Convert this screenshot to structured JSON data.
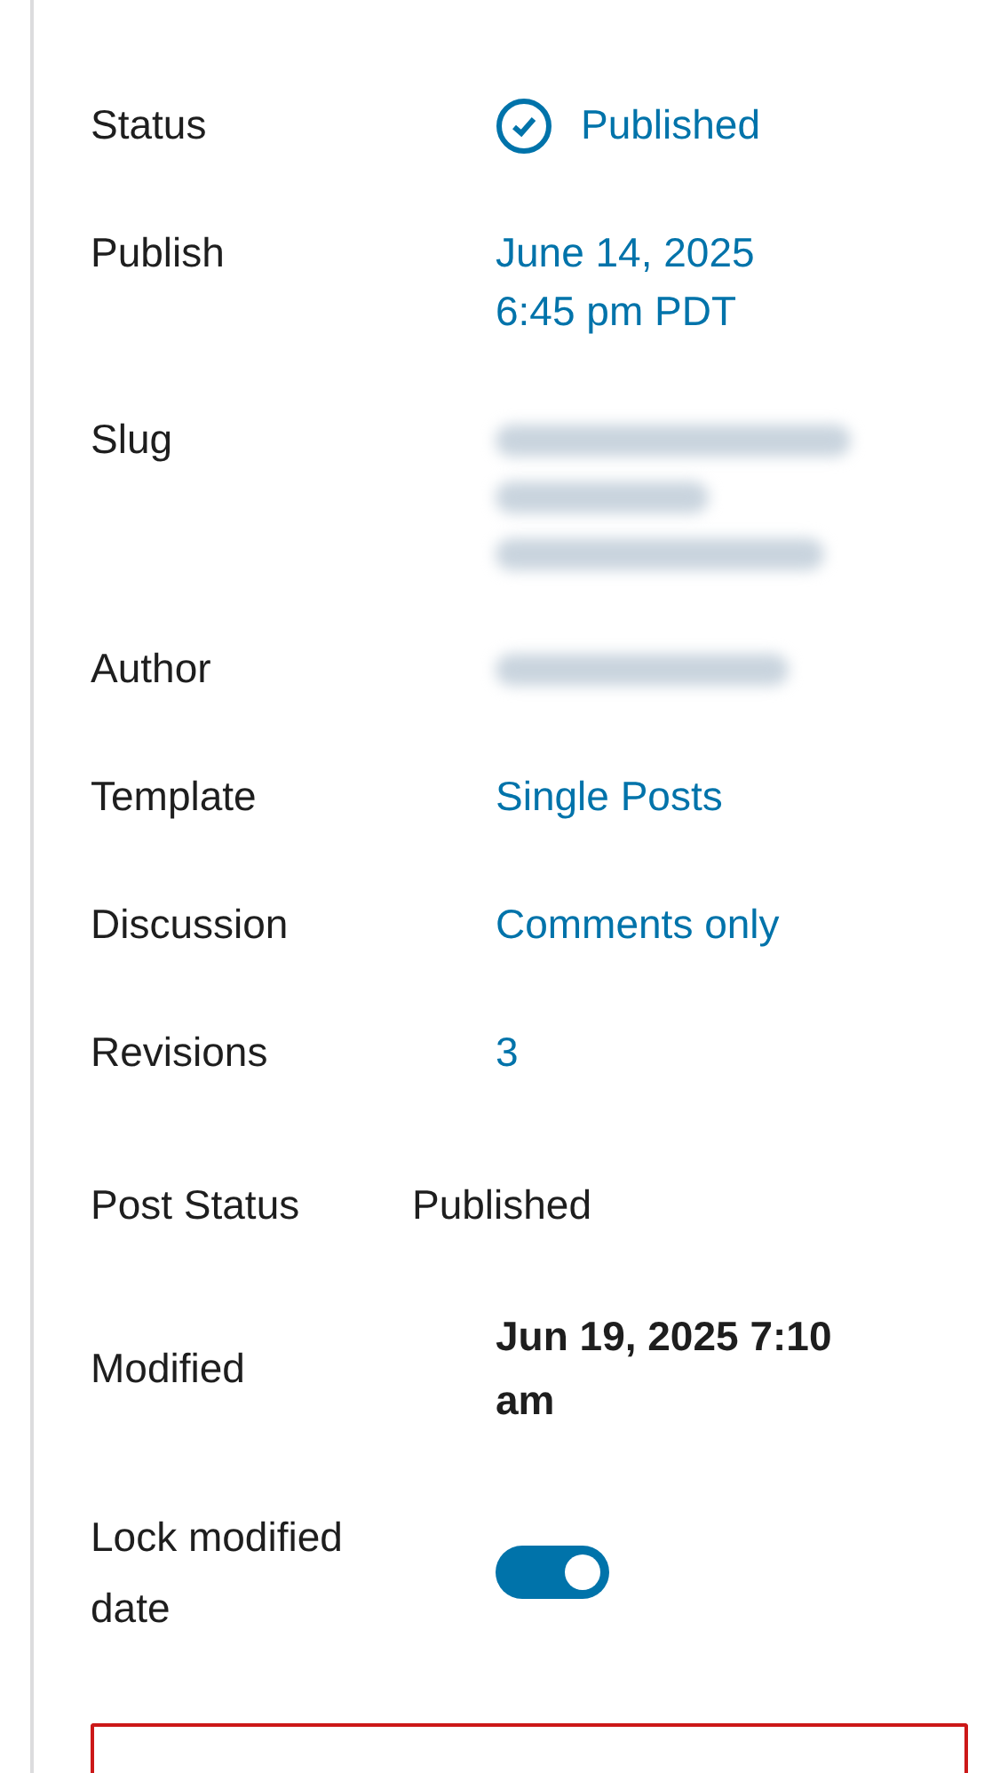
{
  "rows": [
    {
      "kind": "status",
      "label": "Status",
      "value": "Published"
    },
    {
      "kind": "link",
      "label": "Publish",
      "value": "June 14, 2025 6:45 pm PDT"
    },
    {
      "kind": "blurred",
      "label": "Slug",
      "multiline": true
    },
    {
      "kind": "blurred",
      "label": "Author",
      "multiline": false
    },
    {
      "kind": "link",
      "label": "Template",
      "value": "Single Posts"
    },
    {
      "kind": "link",
      "label": "Discussion",
      "value": "Comments only"
    },
    {
      "kind": "link",
      "label": "Revisions",
      "value": "3"
    },
    {
      "kind": "plain",
      "label": "Post Status",
      "value": "Published"
    },
    {
      "kind": "bold",
      "label": "Modified",
      "value": "Jun 19, 2025 7:10 am"
    },
    {
      "kind": "toggle",
      "label": "Lock modified date",
      "on": true
    }
  ],
  "notice": {
    "kind": "error"
  }
}
